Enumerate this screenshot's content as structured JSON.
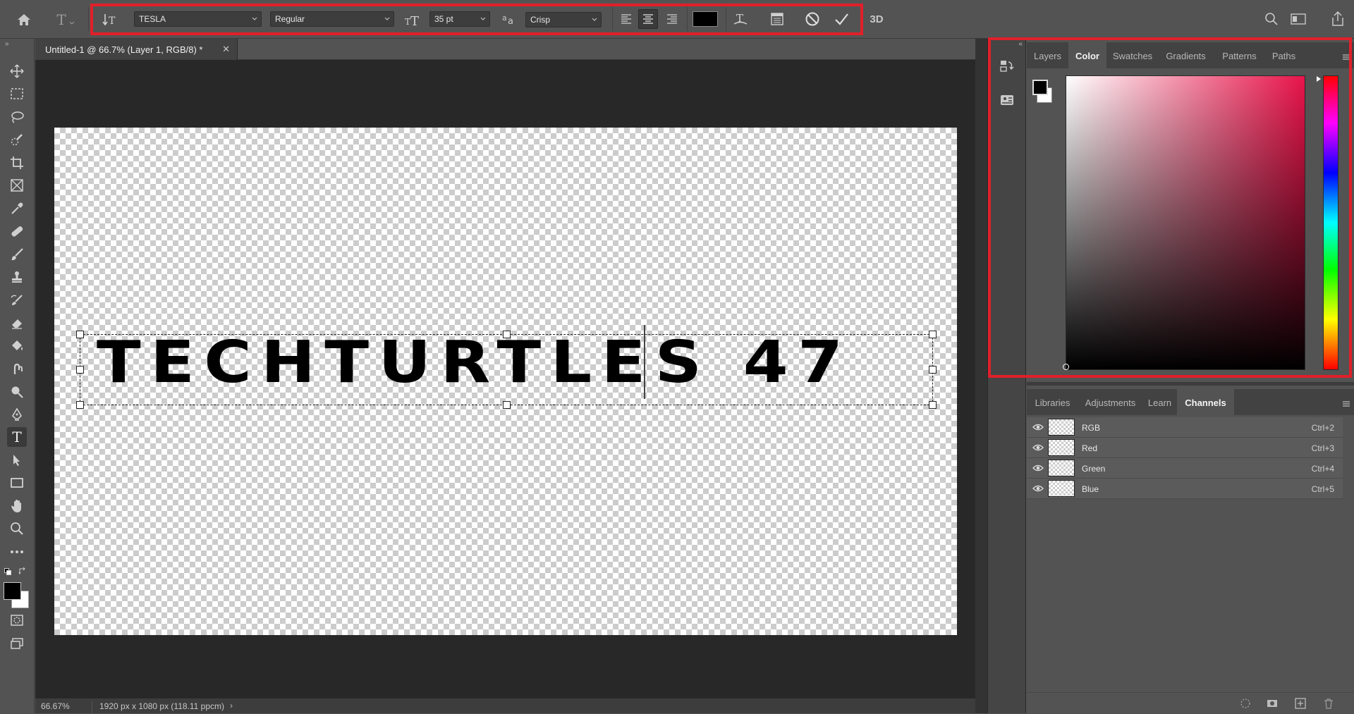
{
  "options_bar": {
    "font_family": "TESLA",
    "font_style": "Regular",
    "font_size": "35 pt",
    "antialias": "Crisp",
    "threed_label": "3D",
    "text_color": "#000000",
    "highlight_color": "#e0202a"
  },
  "document": {
    "tab_title": "Untitled-1 @ 66.7% (Layer 1, RGB/8) *",
    "canvas_text": "TECHTURTLES 47",
    "zoom": "66.67%",
    "doc_info": "1920 px x 1080 px (118.11 ppcm)"
  },
  "top_panel": {
    "tabs": [
      "Layers",
      "Color",
      "Swatches",
      "Gradients",
      "Patterns",
      "Paths"
    ],
    "active_tab": "Color"
  },
  "bottom_panel": {
    "tabs": [
      "Libraries",
      "Adjustments",
      "Learn",
      "Channels"
    ],
    "active_tab": "Channels",
    "channels": [
      {
        "name": "RGB",
        "shortcut": "Ctrl+2"
      },
      {
        "name": "Red",
        "shortcut": "Ctrl+3"
      },
      {
        "name": "Green",
        "shortcut": "Ctrl+4"
      },
      {
        "name": "Blue",
        "shortcut": "Ctrl+5"
      }
    ]
  },
  "colors": {
    "foreground": "#000000",
    "background": "#ffffff",
    "picker_hue": "#e8144a"
  },
  "icons": [
    "home-icon",
    "type-tool-icon",
    "text-orientation-icon",
    "font-size-icon",
    "antialias-icon",
    "align-left-icon",
    "align-center-icon",
    "align-right-icon",
    "warp-text-icon",
    "character-panel-icon",
    "cancel-icon",
    "commit-icon",
    "search-icon",
    "workspace-icon",
    "share-icon"
  ]
}
